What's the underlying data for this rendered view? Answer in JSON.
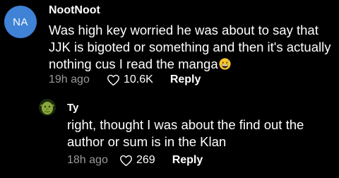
{
  "comments": [
    {
      "avatar_initials": "NA",
      "avatar_color": "#3f82d6",
      "username": "NootNoot",
      "text": "Was high key worried he was about to say that JJK is bigoted or something and then it's actually nothing cus I read the manga",
      "emoji": "grinning-sweat-emoji",
      "time": "19h ago",
      "likes": "10.6K",
      "reply_label": "Reply"
    }
  ],
  "reply": {
    "avatar_icon": "shrek-avatar-icon",
    "username": "Ty",
    "text": "right, thought I was about the find out the author or sum is in the Klan",
    "time": "18h ago",
    "likes": "269",
    "reply_label": "Reply"
  },
  "colors": {
    "background": "#000000",
    "text": "#ffffff",
    "muted": "#9a9a9a"
  }
}
